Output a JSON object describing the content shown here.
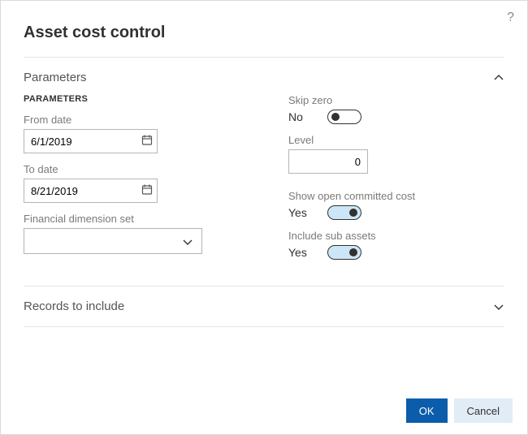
{
  "header": {
    "title": "Asset cost control"
  },
  "sections": {
    "parameters": {
      "title": "Parameters",
      "expanded": true
    },
    "records": {
      "title": "Records to include",
      "expanded": false
    }
  },
  "left": {
    "heading": "PARAMETERS",
    "from_label": "From date",
    "from_value": "6/1/2019",
    "to_label": "To date",
    "to_value": "8/21/2019",
    "fds_label": "Financial dimension set",
    "fds_value": ""
  },
  "right": {
    "skip_label": "Skip zero",
    "skip_value": "No",
    "skip_on": false,
    "level_label": "Level",
    "level_value": "0",
    "open_label": "Show open committed cost",
    "open_value": "Yes",
    "open_on": true,
    "sub_label": "Include sub assets",
    "sub_value": "Yes",
    "sub_on": true
  },
  "footer": {
    "ok": "OK",
    "cancel": "Cancel"
  }
}
